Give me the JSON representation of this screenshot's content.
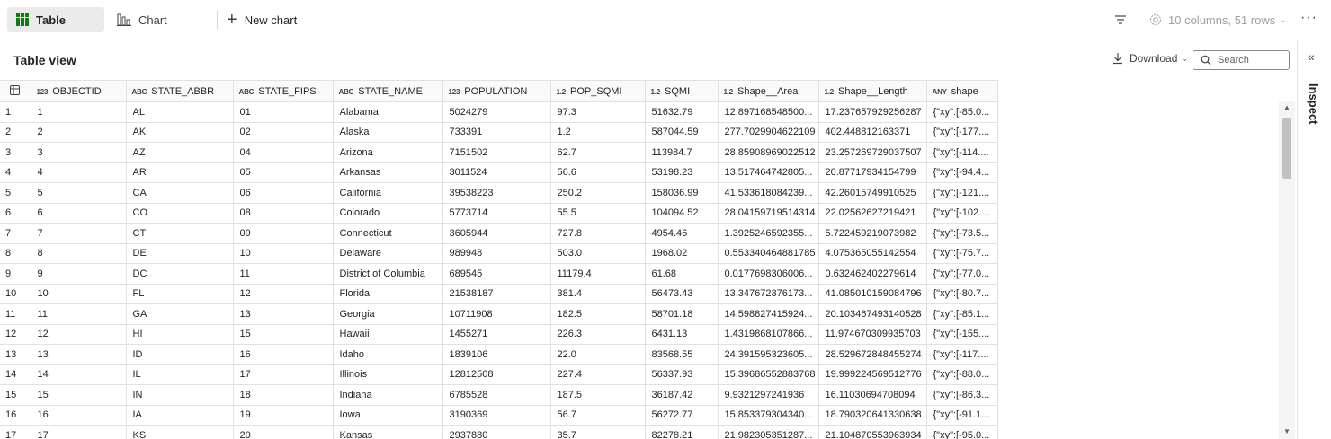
{
  "toolbar": {
    "tab_table": "Table",
    "tab_chart": "Chart",
    "new_chart": "New chart",
    "summary": "10 columns, 51 rows"
  },
  "inspect": {
    "label": "Inspect"
  },
  "table_view": {
    "title": "Table view",
    "download_label": "Download",
    "search_placeholder": "Search"
  },
  "columns": [
    {
      "type": "123",
      "name": "OBJECTID",
      "width": 106
    },
    {
      "type": "ABC",
      "name": "STATE_ABBR",
      "width": 119
    },
    {
      "type": "ABC",
      "name": "STATE_FIPS",
      "width": 111
    },
    {
      "type": "ABC",
      "name": "STATE_NAME",
      "width": 122
    },
    {
      "type": "123",
      "name": "POPULATION",
      "width": 120
    },
    {
      "type": "1.2",
      "name": "POP_SQMI",
      "width": 105
    },
    {
      "type": "1.2",
      "name": "SQMI",
      "width": 81
    },
    {
      "type": "1.2",
      "name": "Shape__Area",
      "width": 112
    },
    {
      "type": "1.2",
      "name": "Shape__Length",
      "width": 120
    },
    {
      "type": "ANY",
      "name": "shape",
      "width": 79
    }
  ],
  "rows": [
    [
      "1",
      "1",
      "AL",
      "01",
      "Alabama",
      "5024279",
      "97.3",
      "51632.79",
      "12.897168548500...",
      "17.237657929256287",
      "{\"xy\":[-85.0..."
    ],
    [
      "2",
      "2",
      "AK",
      "02",
      "Alaska",
      "733391",
      "1.2",
      "587044.59",
      "277.7029904622109",
      "402.448812163371",
      "{\"xy\":[-177...."
    ],
    [
      "3",
      "3",
      "AZ",
      "04",
      "Arizona",
      "7151502",
      "62.7",
      "113984.7",
      "28.85908969022512",
      "23.257269729037507",
      "{\"xy\":[-114...."
    ],
    [
      "4",
      "4",
      "AR",
      "05",
      "Arkansas",
      "3011524",
      "56.6",
      "53198.23",
      "13.517464742805...",
      "20.87717934154799",
      "{\"xy\":[-94.4..."
    ],
    [
      "5",
      "5",
      "CA",
      "06",
      "California",
      "39538223",
      "250.2",
      "158036.99",
      "41.533618084239...",
      "42.26015749910525",
      "{\"xy\":[-121...."
    ],
    [
      "6",
      "6",
      "CO",
      "08",
      "Colorado",
      "5773714",
      "55.5",
      "104094.52",
      "28.04159719514314",
      "22.02562627219421",
      "{\"xy\":[-102...."
    ],
    [
      "7",
      "7",
      "CT",
      "09",
      "Connecticut",
      "3605944",
      "727.8",
      "4954.46",
      "1.3925246592355...",
      "5.722459219073982",
      "{\"xy\":[-73.5..."
    ],
    [
      "8",
      "8",
      "DE",
      "10",
      "Delaware",
      "989948",
      "503.0",
      "1968.02",
      "0.553340464881785",
      "4.075365055142554",
      "{\"xy\":[-75.7..."
    ],
    [
      "9",
      "9",
      "DC",
      "11",
      "District of Columbia",
      "689545",
      "11179.4",
      "61.68",
      "0.0177698306006...",
      "0.632462402279614",
      "{\"xy\":[-77.0..."
    ],
    [
      "10",
      "10",
      "FL",
      "12",
      "Florida",
      "21538187",
      "381.4",
      "56473.43",
      "13.347672376173...",
      "41.085010159084796",
      "{\"xy\":[-80.7..."
    ],
    [
      "11",
      "11",
      "GA",
      "13",
      "Georgia",
      "10711908",
      "182.5",
      "58701.18",
      "14.598827415924...",
      "20.103467493140528",
      "{\"xy\":[-85.1..."
    ],
    [
      "12",
      "12",
      "HI",
      "15",
      "Hawaii",
      "1455271",
      "226.3",
      "6431.13",
      "1.4319868107866...",
      "11.974670309935703",
      "{\"xy\":[-155...."
    ],
    [
      "13",
      "13",
      "ID",
      "16",
      "Idaho",
      "1839106",
      "22.0",
      "83568.55",
      "24.391595323605...",
      "28.529672848455274",
      "{\"xy\":[-117...."
    ],
    [
      "14",
      "14",
      "IL",
      "17",
      "Illinois",
      "12812508",
      "227.4",
      "56337.93",
      "15.39686552883768",
      "19.999224569512776",
      "{\"xy\":[-88.0..."
    ],
    [
      "15",
      "15",
      "IN",
      "18",
      "Indiana",
      "6785528",
      "187.5",
      "36187.42",
      "9.9321297241936",
      "16.11030694708094",
      "{\"xy\":[-86.3..."
    ],
    [
      "16",
      "16",
      "IA",
      "19",
      "Iowa",
      "3190369",
      "56.7",
      "56272.77",
      "15.853379304340...",
      "18.790320641330638",
      "{\"xy\":[-91.1..."
    ],
    [
      "17",
      "17",
      "KS",
      "20",
      "Kansas",
      "2937880",
      "35.7",
      "82278.21",
      "21.982305351287...",
      "21.104870553963934",
      "{\"xy\":[-95.0..."
    ]
  ]
}
